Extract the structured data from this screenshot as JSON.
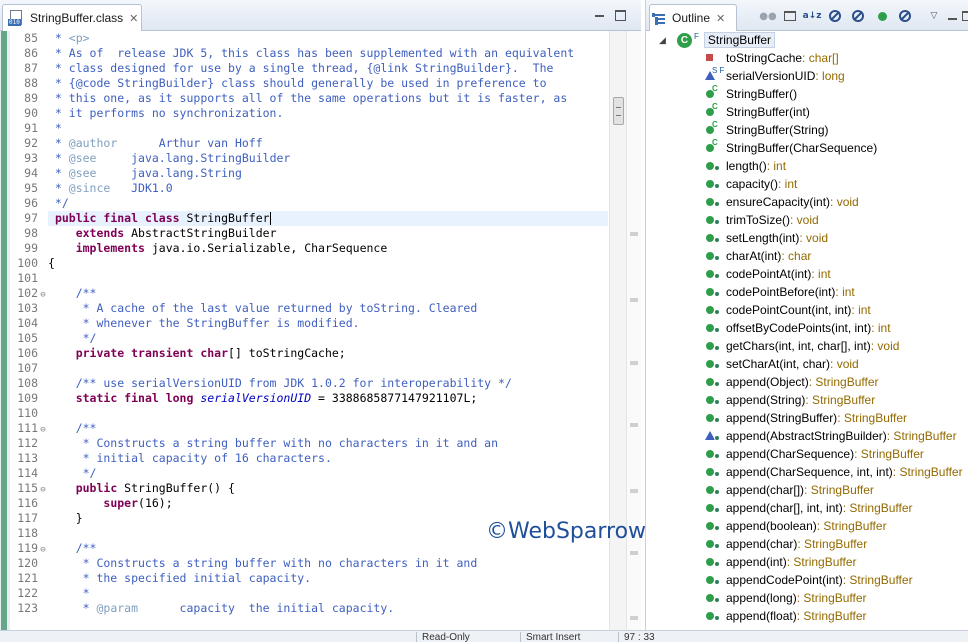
{
  "editor": {
    "tab_title": "StringBuffer.class",
    "tab_icon": "class-file-icon",
    "lines": [
      {
        "n": "85",
        "fold": "",
        "segs": [
          [
            "c",
            " * "
          ],
          [
            "t",
            "<p>"
          ]
        ]
      },
      {
        "n": "86",
        "fold": "",
        "segs": [
          [
            "c",
            " * As of  release JDK 5, this class has been supplemented with an equivalent"
          ]
        ]
      },
      {
        "n": "87",
        "fold": "",
        "segs": [
          [
            "c",
            " * class designed for use by a single thread, {@link StringBuilder}.  The"
          ]
        ]
      },
      {
        "n": "88",
        "fold": "",
        "segs": [
          [
            "c",
            " * {@code StringBuilder} class should generally be used in preference to"
          ]
        ]
      },
      {
        "n": "89",
        "fold": "",
        "segs": [
          [
            "c",
            " * this one, as it supports all of the same operations but it is faster, as"
          ]
        ]
      },
      {
        "n": "90",
        "fold": "",
        "segs": [
          [
            "c",
            " * it performs no synchronization."
          ]
        ]
      },
      {
        "n": "91",
        "fold": "",
        "segs": [
          [
            "c",
            " *"
          ]
        ]
      },
      {
        "n": "92",
        "fold": "",
        "segs": [
          [
            "c",
            " * "
          ],
          [
            "t",
            "@author"
          ],
          [
            "c",
            "      Arthur van Hoff"
          ]
        ]
      },
      {
        "n": "93",
        "fold": "",
        "segs": [
          [
            "c",
            " * "
          ],
          [
            "t",
            "@see"
          ],
          [
            "c",
            "     java.lang.StringBuilder"
          ]
        ]
      },
      {
        "n": "94",
        "fold": "",
        "segs": [
          [
            "c",
            " * "
          ],
          [
            "t",
            "@see"
          ],
          [
            "c",
            "     java.lang.String"
          ]
        ]
      },
      {
        "n": "95",
        "fold": "",
        "segs": [
          [
            "c",
            " * "
          ],
          [
            "t",
            "@since"
          ],
          [
            "c",
            "   JDK1.0"
          ]
        ]
      },
      {
        "n": "96",
        "fold": "",
        "segs": [
          [
            "c",
            " */"
          ]
        ]
      },
      {
        "n": "97",
        "fold": "",
        "segs": [
          [
            "p",
            " "
          ],
          [
            "k",
            "public final class"
          ],
          [
            "p",
            " StringBuffer"
          ]
        ],
        "caret": true
      },
      {
        "n": "98",
        "fold": "",
        "segs": [
          [
            "p",
            "    "
          ],
          [
            "k",
            "extends"
          ],
          [
            "p",
            " AbstractStringBuilder"
          ]
        ]
      },
      {
        "n": "99",
        "fold": "",
        "segs": [
          [
            "p",
            "    "
          ],
          [
            "k",
            "implements"
          ],
          [
            "p",
            " java.io.Serializable, CharSequence"
          ]
        ]
      },
      {
        "n": "100",
        "fold": "",
        "segs": [
          [
            "p",
            "{"
          ]
        ]
      },
      {
        "n": "101",
        "fold": "",
        "segs": []
      },
      {
        "n": "102",
        "fold": "⊖",
        "segs": [
          [
            "c",
            "    /**"
          ]
        ]
      },
      {
        "n": "103",
        "fold": "",
        "segs": [
          [
            "c",
            "     * A cache of the last value returned by toString. Cleared"
          ]
        ]
      },
      {
        "n": "104",
        "fold": "",
        "segs": [
          [
            "c",
            "     * whenever the StringBuffer is modified."
          ]
        ]
      },
      {
        "n": "105",
        "fold": "",
        "segs": [
          [
            "c",
            "     */"
          ]
        ]
      },
      {
        "n": "106",
        "fold": "",
        "segs": [
          [
            "p",
            "    "
          ],
          [
            "k",
            "private transient char"
          ],
          [
            "p",
            "[] toStringCache;"
          ]
        ]
      },
      {
        "n": "107",
        "fold": "",
        "segs": []
      },
      {
        "n": "108",
        "fold": "",
        "segs": [
          [
            "c",
            "    /** use serialVersionUID from JDK 1.0.2 for interoperability */"
          ]
        ]
      },
      {
        "n": "109",
        "fold": "",
        "segs": [
          [
            "p",
            "    "
          ],
          [
            "k",
            "static final long"
          ],
          [
            "p",
            " "
          ],
          [
            "f",
            "serialVersionUID"
          ],
          [
            "p",
            " = 3388685877147921107L;"
          ]
        ]
      },
      {
        "n": "110",
        "fold": "",
        "segs": []
      },
      {
        "n": "111",
        "fold": "⊖",
        "segs": [
          [
            "c",
            "    /**"
          ]
        ]
      },
      {
        "n": "112",
        "fold": "",
        "segs": [
          [
            "c",
            "     * Constructs a string buffer with no characters in it and an"
          ]
        ]
      },
      {
        "n": "113",
        "fold": "",
        "segs": [
          [
            "c",
            "     * initial capacity of 16 characters."
          ]
        ]
      },
      {
        "n": "114",
        "fold": "",
        "segs": [
          [
            "c",
            "     */"
          ]
        ]
      },
      {
        "n": "115",
        "fold": "⊖",
        "segs": [
          [
            "p",
            "    "
          ],
          [
            "k",
            "public"
          ],
          [
            "p",
            " StringBuffer() {"
          ]
        ]
      },
      {
        "n": "116",
        "fold": "",
        "segs": [
          [
            "p",
            "        "
          ],
          [
            "k",
            "super"
          ],
          [
            "p",
            "(16);"
          ]
        ]
      },
      {
        "n": "117",
        "fold": "",
        "segs": [
          [
            "p",
            "    }"
          ]
        ]
      },
      {
        "n": "118",
        "fold": "",
        "segs": []
      },
      {
        "n": "119",
        "fold": "⊖",
        "segs": [
          [
            "c",
            "    /**"
          ]
        ]
      },
      {
        "n": "120",
        "fold": "",
        "segs": [
          [
            "c",
            "     * Constructs a string buffer with no characters in it and"
          ]
        ]
      },
      {
        "n": "121",
        "fold": "",
        "segs": [
          [
            "c",
            "     * the specified initial capacity."
          ]
        ]
      },
      {
        "n": "122",
        "fold": "",
        "segs": [
          [
            "c",
            "     *"
          ]
        ]
      },
      {
        "n": "123",
        "fold": "",
        "segs": [
          [
            "c",
            "     * "
          ],
          [
            "t",
            "@param"
          ],
          [
            "c",
            "      capacity  the initial capacity."
          ]
        ]
      }
    ]
  },
  "watermark": "©WebSparrow.org",
  "outline": {
    "tab_title": "Outline",
    "toolbar_icons": [
      "hide-non-public-icon",
      "collapse-all-icon",
      "sort-az-icon",
      "hide-fields-icon",
      "hide-static-icon",
      "hide-non-public-members-icon",
      "hide-local-types-icon",
      "link-with-editor-icon",
      "view-menu-icon",
      "minimize-icon",
      "maximize-icon"
    ],
    "root": {
      "label": "StringBuffer",
      "modifier": "F"
    },
    "members": [
      {
        "name": "toStringCache",
        "type": " : char[]",
        "icon": "private-field"
      },
      {
        "name": "serialVersionUID",
        "type": " : long",
        "icon": "static-final-field"
      },
      {
        "name": "StringBuffer()",
        "type": "",
        "icon": "constructor"
      },
      {
        "name": "StringBuffer(int)",
        "type": "",
        "icon": "constructor"
      },
      {
        "name": "StringBuffer(String)",
        "type": "",
        "icon": "constructor"
      },
      {
        "name": "StringBuffer(CharSequence)",
        "type": "",
        "icon": "constructor"
      },
      {
        "name": "length()",
        "type": " : int",
        "icon": "public-method"
      },
      {
        "name": "capacity()",
        "type": " : int",
        "icon": "public-method"
      },
      {
        "name": "ensureCapacity(int)",
        "type": " : void",
        "icon": "public-method"
      },
      {
        "name": "trimToSize()",
        "type": " : void",
        "icon": "public-method"
      },
      {
        "name": "setLength(int)",
        "type": " : void",
        "icon": "public-method"
      },
      {
        "name": "charAt(int)",
        "type": " : char",
        "icon": "public-method"
      },
      {
        "name": "codePointAt(int)",
        "type": " : int",
        "icon": "public-method"
      },
      {
        "name": "codePointBefore(int)",
        "type": " : int",
        "icon": "public-method"
      },
      {
        "name": "codePointCount(int, int)",
        "type": " : int",
        "icon": "public-method"
      },
      {
        "name": "offsetByCodePoints(int, int)",
        "type": " : int",
        "icon": "public-method"
      },
      {
        "name": "getChars(int, int, char[], int)",
        "type": " : void",
        "icon": "public-method"
      },
      {
        "name": "setCharAt(int, char)",
        "type": " : void",
        "icon": "public-method"
      },
      {
        "name": "append(Object)",
        "type": " : StringBuffer",
        "icon": "public-method"
      },
      {
        "name": "append(String)",
        "type": " : StringBuffer",
        "icon": "public-method"
      },
      {
        "name": "append(StringBuffer)",
        "type": " : StringBuffer",
        "icon": "public-method"
      },
      {
        "name": "append(AbstractStringBuilder)",
        "type": " : StringBuffer",
        "icon": "protected-method"
      },
      {
        "name": "append(CharSequence)",
        "type": " : StringBuffer",
        "icon": "public-method"
      },
      {
        "name": "append(CharSequence, int, int)",
        "type": " : StringBuffer",
        "icon": "public-method"
      },
      {
        "name": "append(char[])",
        "type": " : StringBuffer",
        "icon": "public-method"
      },
      {
        "name": "append(char[], int, int)",
        "type": " : StringBuffer",
        "icon": "public-method"
      },
      {
        "name": "append(boolean)",
        "type": " : StringBuffer",
        "icon": "public-method"
      },
      {
        "name": "append(char)",
        "type": " : StringBuffer",
        "icon": "public-method"
      },
      {
        "name": "append(int)",
        "type": " : StringBuffer",
        "icon": "public-method"
      },
      {
        "name": "appendCodePoint(int)",
        "type": " : StringBuffer",
        "icon": "public-method"
      },
      {
        "name": "append(long)",
        "type": " : StringBuffer",
        "icon": "public-method"
      },
      {
        "name": "append(float)",
        "type": " : StringBuffer",
        "icon": "public-method"
      }
    ]
  },
  "status": {
    "read_only": "Read-Only",
    "insert_mode": "Smart Insert",
    "position": "97 : 33"
  },
  "colors": {
    "javadoc_comment": "#3f5fbf",
    "javadoc_tag": "#7f9fbf",
    "keyword": "#7f0055",
    "static_field": "#0000c0",
    "return_type": "#946a00",
    "public_icon": "#2f9e4a",
    "watermark": "#1f4f9a"
  }
}
